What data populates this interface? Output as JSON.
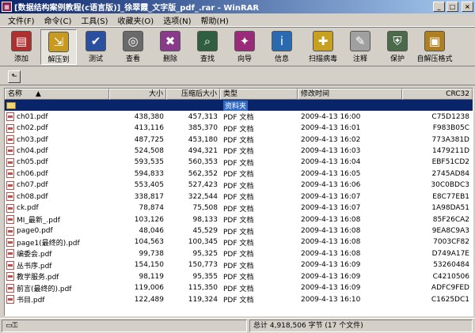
{
  "window": {
    "title": "[数据结构案例教程(c语言版)]_徐翠霞_文字版_pdf_.rar - WinRAR",
    "app_icon": "winrar-icon",
    "buttons": {
      "minimize": "_",
      "maximize": "□",
      "close": "×"
    }
  },
  "menu": [
    "文件(F)",
    "命令(C)",
    "工具(S)",
    "收藏夹(O)",
    "选项(N)",
    "帮助(H)"
  ],
  "toolbar": [
    {
      "label": "添加",
      "icon": "add-archive-icon",
      "color": "#b03030",
      "glyph": "▤"
    },
    {
      "label": "解压到",
      "icon": "extract-to-icon",
      "color": "#c89a20",
      "glyph": "⇲",
      "active": true
    },
    {
      "label": "测试",
      "icon": "test-icon",
      "color": "#2a4fa0",
      "glyph": "✔"
    },
    {
      "label": "查看",
      "icon": "view-icon",
      "color": "#6a6a6a",
      "glyph": "◎"
    },
    {
      "label": "删除",
      "icon": "delete-icon",
      "color": "#8a3a8a",
      "glyph": "✖"
    },
    {
      "label": "查找",
      "icon": "find-icon",
      "color": "#2f5f3f",
      "glyph": "⌕"
    },
    {
      "label": "向导",
      "icon": "wizard-icon",
      "color": "#9a2a7a",
      "glyph": "✦"
    },
    {
      "label": "信息",
      "icon": "info-icon",
      "color": "#2a6ab0",
      "glyph": "i"
    },
    {
      "label": "扫描病毒",
      "icon": "virus-scan-icon",
      "color": "#c8a020",
      "glyph": "✚",
      "gap": true
    },
    {
      "label": "注释",
      "icon": "comment-icon",
      "color": "#a0a0a0",
      "glyph": "✎"
    },
    {
      "label": "保护",
      "icon": "protect-icon",
      "color": "#4a6a4a",
      "glyph": "⛨"
    },
    {
      "label": "自解压格式",
      "icon": "sfx-icon",
      "color": "#b08020",
      "glyph": "▣"
    }
  ],
  "address": {
    "up_icon": "up-folder-icon"
  },
  "columns": {
    "name": "名称",
    "size": "大小",
    "packed": "压缩后大小",
    "type": "类型",
    "modified": "修改时间",
    "crc": "CRC32",
    "sort_icon": "sort-arrow-icon"
  },
  "parent_row": {
    "type": "资料夹"
  },
  "files": [
    {
      "name": "ch01.pdf",
      "size": "438,380",
      "packed": "457,313",
      "type": "PDF 文档",
      "modified": "2009-4-13 16:00",
      "crc": "C75D1238"
    },
    {
      "name": "ch02.pdf",
      "size": "413,116",
      "packed": "385,370",
      "type": "PDF 文档",
      "modified": "2009-4-13 16:01",
      "crc": "F983B05C"
    },
    {
      "name": "ch03.pdf",
      "size": "487,725",
      "packed": "453,180",
      "type": "PDF 文档",
      "modified": "2009-4-13 16:02",
      "crc": "773A381D"
    },
    {
      "name": "ch04.pdf",
      "size": "524,508",
      "packed": "494,321",
      "type": "PDF 文档",
      "modified": "2009-4-13 16:03",
      "crc": "1479211D"
    },
    {
      "name": "ch05.pdf",
      "size": "593,535",
      "packed": "560,353",
      "type": "PDF 文档",
      "modified": "2009-4-13 16:04",
      "crc": "EBF51CD2"
    },
    {
      "name": "ch06.pdf",
      "size": "594,833",
      "packed": "562,352",
      "type": "PDF 文档",
      "modified": "2009-4-13 16:05",
      "crc": "2745AD84"
    },
    {
      "name": "ch07.pdf",
      "size": "553,405",
      "packed": "527,423",
      "type": "PDF 文档",
      "modified": "2009-4-13 16:06",
      "crc": "30C0BDC3"
    },
    {
      "name": "ch08.pdf",
      "size": "338,817",
      "packed": "322,544",
      "type": "PDF 文档",
      "modified": "2009-4-13 16:07",
      "crc": "E8C77EB1"
    },
    {
      "name": "ck.pdf",
      "size": "78,874",
      "packed": "75,508",
      "type": "PDF 文档",
      "modified": "2009-4-13 16:07",
      "crc": "1A98DA51"
    },
    {
      "name": "MI_最新_.pdf",
      "size": "103,126",
      "packed": "98,133",
      "type": "PDF 文档",
      "modified": "2009-4-13 16:08",
      "crc": "85F26CA2"
    },
    {
      "name": "page0.pdf",
      "size": "48,046",
      "packed": "45,529",
      "type": "PDF 文档",
      "modified": "2009-4-13 16:08",
      "crc": "9EA8C9A3"
    },
    {
      "name": "page1(最终的).pdf",
      "size": "104,563",
      "packed": "100,345",
      "type": "PDF 文档",
      "modified": "2009-4-13 16:08",
      "crc": "7003CF82"
    },
    {
      "name": "编委会.pdf",
      "size": "99,738",
      "packed": "95,325",
      "type": "PDF 文档",
      "modified": "2009-4-13 16:08",
      "crc": "D749A17E"
    },
    {
      "name": "丛书序.pdf",
      "size": "154,150",
      "packed": "150,773",
      "type": "PDF 文档",
      "modified": "2009-4-13 16:09",
      "crc": "53260484"
    },
    {
      "name": "教学服务.pdf",
      "size": "98,119",
      "packed": "95,355",
      "type": "PDF 文档",
      "modified": "2009-4-13 16:09",
      "crc": "C4210506"
    },
    {
      "name": "前言(最终的).pdf",
      "size": "119,006",
      "packed": "115,350",
      "type": "PDF 文档",
      "modified": "2009-4-13 16:09",
      "crc": "ADFC9FED"
    },
    {
      "name": "书目.pdf",
      "size": "122,489",
      "packed": "119,324",
      "type": "PDF 文档",
      "modified": "2009-4-13 16:10",
      "crc": "C1625DC1"
    }
  ],
  "status": {
    "left_icon": "drive-key-icon",
    "summary": "总计 4,918,506 字节 (17 个文件)"
  }
}
